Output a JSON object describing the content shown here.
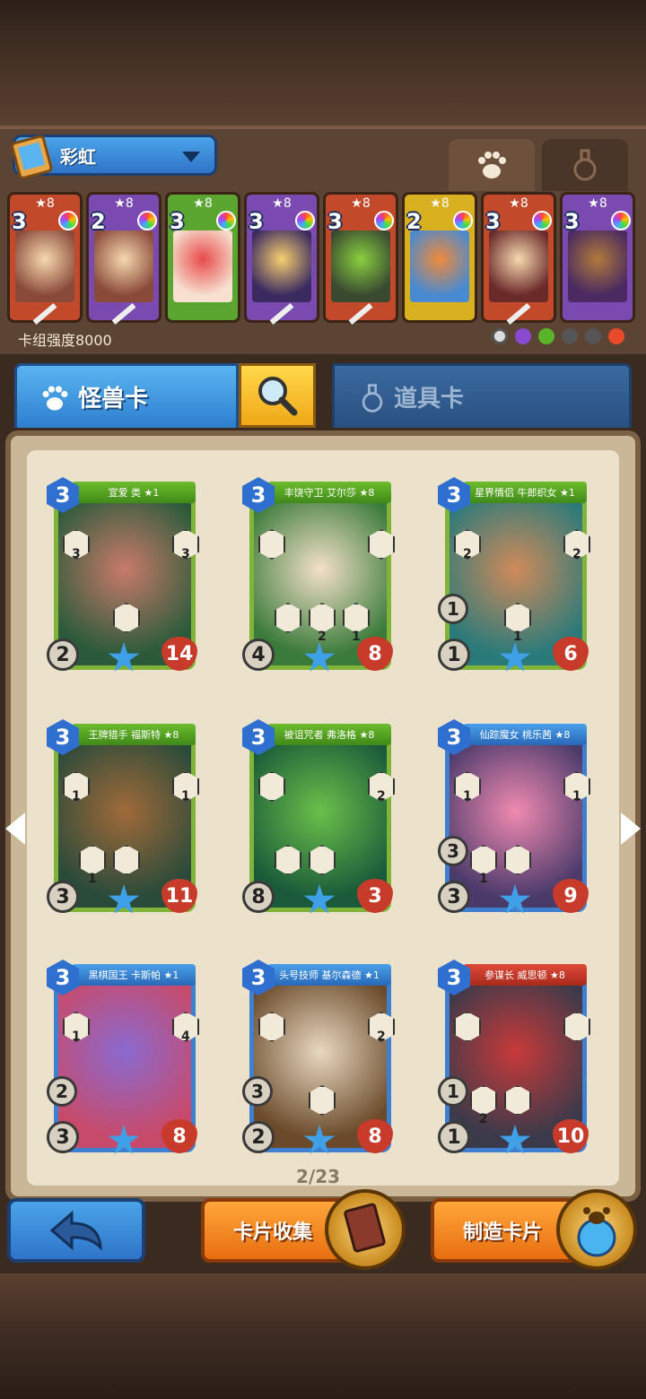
{
  "deck": {
    "name": "彩虹",
    "strength_label": "卡组强度8000",
    "cards": [
      {
        "star": "★8",
        "cost": "3",
        "color": "#c24a2a"
      },
      {
        "star": "★8",
        "cost": "2",
        "color": "#7a4ab0"
      },
      {
        "star": "★8",
        "cost": "3",
        "color": "#5aa630"
      },
      {
        "star": "★8",
        "cost": "3",
        "color": "#7a4ab0"
      },
      {
        "star": "★8",
        "cost": "3",
        "color": "#c24a2a"
      },
      {
        "star": "★8",
        "cost": "2",
        "color": "#d8b020"
      },
      {
        "star": "★8",
        "cost": "3",
        "color": "#c24a2a"
      },
      {
        "star": "★8",
        "cost": "3",
        "color": "#7a4ab0"
      }
    ]
  },
  "tabs": {
    "monster_label": "怪兽卡",
    "item_label": "道具卡"
  },
  "cards": [
    {
      "title": "宣爱 类 ★1",
      "cost": "3",
      "atk": "2",
      "hp": "14",
      "frame": "green",
      "s1": "3",
      "s2": "3",
      "mid": ""
    },
    {
      "title": "丰饶守卫 艾尔莎 ★8",
      "cost": "3",
      "atk": "4",
      "hp": "8",
      "frame": "green",
      "s1": "",
      "s2": "",
      "mid": "2",
      "mid2": "1"
    },
    {
      "title": "星界情侣 牛郎织女 ★1",
      "cost": "3",
      "atk": "1",
      "hp": "6",
      "frame": "green",
      "s1": "2",
      "s2": "2",
      "mid": "1",
      "extra": "1"
    },
    {
      "title": "王牌猎手 福斯特 ★8",
      "cost": "3",
      "atk": "3",
      "hp": "11",
      "frame": "green",
      "s1": "1",
      "s2": "1",
      "mid": "1"
    },
    {
      "title": "被诅咒者 弗洛格 ★8",
      "cost": "3",
      "atk": "8",
      "hp": "3",
      "frame": "green",
      "s1": "",
      "s2": "2",
      "mid": ""
    },
    {
      "title": "仙踪魔女 桃乐茜 ★8",
      "cost": "3",
      "atk": "3",
      "hp": "9",
      "frame": "blue",
      "s1": "1",
      "s2": "1",
      "mid": "1",
      "extra": "3"
    },
    {
      "title": "黑棋国王 卡斯帕 ★1",
      "cost": "3",
      "atk": "3",
      "hp": "8",
      "frame": "blue",
      "s1": "1",
      "s2": "4",
      "mid": "",
      "extra": "2"
    },
    {
      "title": "头号技师 基尔森德 ★1",
      "cost": "3",
      "atk": "2",
      "hp": "8",
      "frame": "blue",
      "s1": "",
      "s2": "2",
      "mid": "",
      "extra": "3"
    },
    {
      "title": "参谋长 威思顿 ★8",
      "cost": "3",
      "atk": "1",
      "hp": "10",
      "frame": "blue",
      "s1": "",
      "s2": "",
      "mid": "2",
      "extra": "1"
    }
  ],
  "pagination": "2/23",
  "buttons": {
    "collect_label": "卡片收集",
    "craft_label": "制造卡片"
  }
}
